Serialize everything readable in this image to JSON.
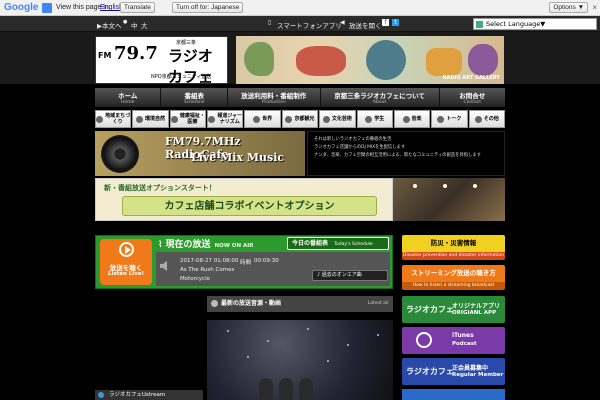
{
  "gtranslate": {
    "logo": "Google",
    "view_text": "View this page in:",
    "language": "English",
    "translate_label": "Translate",
    "turn_off_label": "Turn off for: Japanese",
    "options_label": "Options ▼",
    "close": "×"
  },
  "topbar": {
    "text_label": "▶本文へ",
    "size_medium": "中",
    "size_large": "大",
    "smartphone": "スマートフォンアプリ",
    "listen": "放送を聞く",
    "select_language": "Select Language▼"
  },
  "logo": {
    "fm": "FM",
    "freq": "79.7",
    "area": "京都三条",
    "name": "ラジオカフェ",
    "npo": "NPO京都コミュニティ放送"
  },
  "banner": {
    "caption": "RADIO ART GALLERY"
  },
  "main_nav": [
    {
      "label": "ホーム",
      "sub": "Home"
    },
    {
      "label": "番組表",
      "sub": "Schedule"
    },
    {
      "label": "放送利用料・番組制作",
      "sub": "Production"
    },
    {
      "label": "京都三条ラジオカフェについて",
      "sub": "About"
    },
    {
      "label": "お問合せ",
      "sub": "Contact"
    }
  ],
  "categories": [
    "地域まちづくり",
    "環境自然",
    "健康福祉・医療",
    "報道ジャーナリズム",
    "世界",
    "京都観光",
    "文化芸術",
    "学生",
    "音楽",
    "トーク",
    "その他"
  ],
  "feature": {
    "line1": "FM79.7MHz  RadioCafe",
    "line2": "Live Mix Music",
    "desc": [
      "それは新しいラジオカフェの番組の生活",
      "ラジオカフェ店舗からのDJ MIXを生配信します",
      "ナンダ、音楽、カフェ空間の相互活用による、新たなコミュニティの創造を目指します"
    ]
  },
  "collab": {
    "sub": "新・番組放送オプションスタート！",
    "main": "カフェ店舗コラボイベントオプション"
  },
  "onair": {
    "listen_jp": "放送を聴く",
    "listen_en": "Listen Live!",
    "title": "現在の放送",
    "title_en": "NOW ON AIR",
    "today_label": "今日の番組表",
    "today_en": "Today's Schedule",
    "datetime": "2017-08-27 01:08:00",
    "duration": "00:09:30",
    "song": "As The Rush Comes",
    "artist": "Motorcycle",
    "past_label": "過去のオンエア曲"
  },
  "media": {
    "title": "最新の放送音源・動画",
    "latest": "Latest air"
  },
  "ustream": {
    "label": "ラジオカフェUstream"
  },
  "right_col": {
    "disaster_title": "防災・災害情報",
    "disaster_sub": "Disaster prevention and disaster information",
    "stream_title": "ストリーミング放送の聴き方",
    "stream_sub": "How to listen a streaming broadcast",
    "app_rc": "ラジオカフェ",
    "app_t1": "オリジナルアプリ",
    "app_t2": "ORIGIANL APP",
    "itunes_t1": "iTunes",
    "itunes_t2": "Podcast",
    "member_rc": "ラジオカフェ",
    "member_t1": "正会員募集中",
    "member_t2": "Regular Member"
  },
  "colors": {
    "onair_green": "#2c9a2c",
    "listen_orange": "#f07a1a",
    "disaster_yellow": "#f0d020"
  }
}
